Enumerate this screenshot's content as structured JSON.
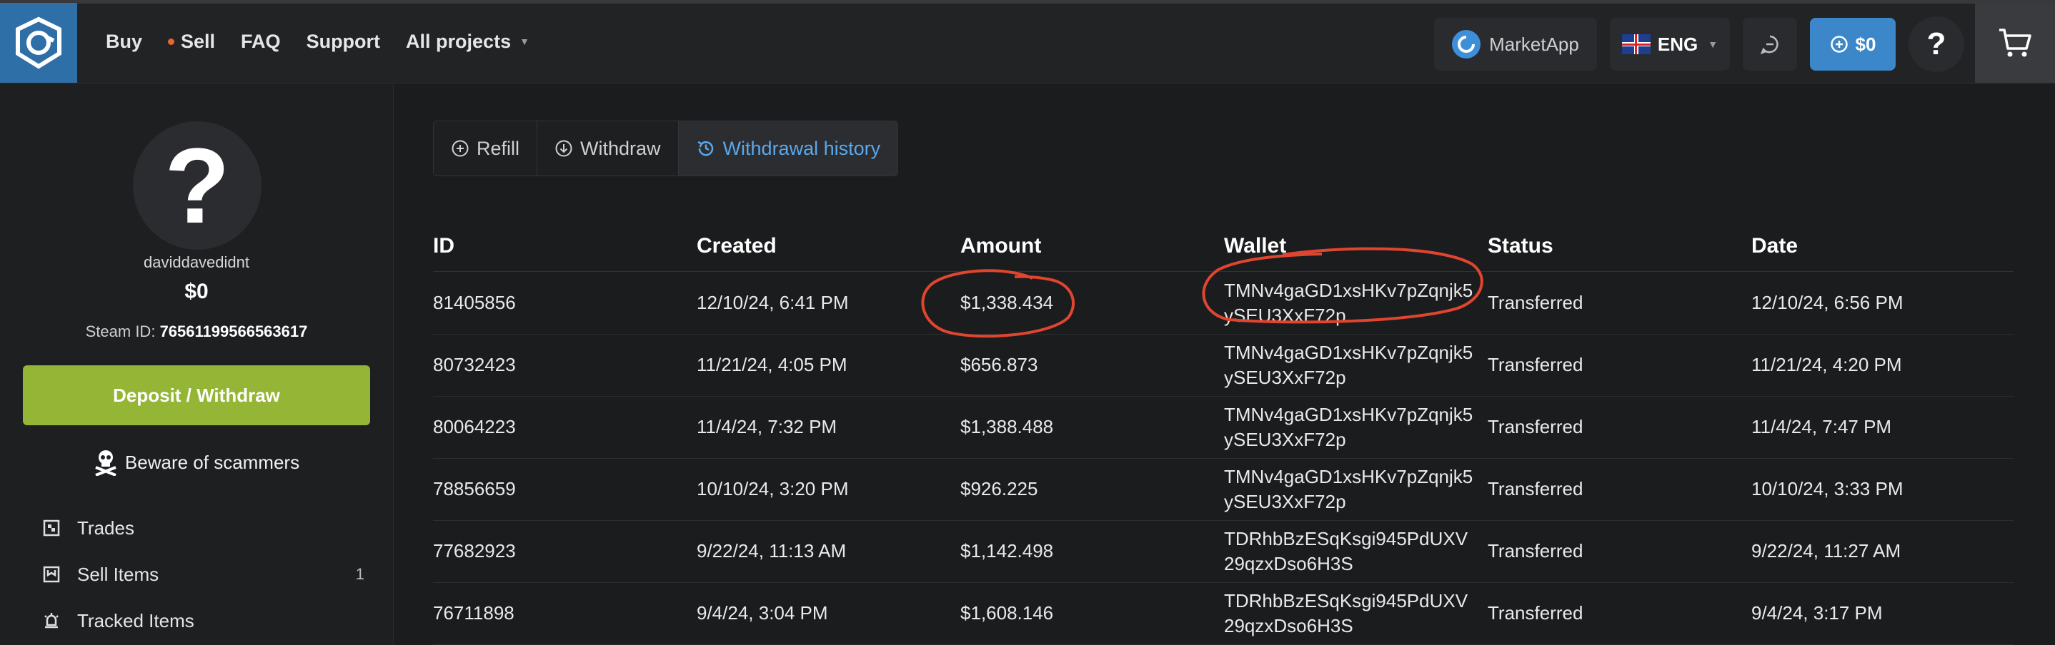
{
  "nav": {
    "items": [
      "Buy",
      "Sell",
      "FAQ",
      "Support",
      "All projects"
    ]
  },
  "topbar": {
    "market_label": "MarketApp",
    "lang_label": "ENG",
    "balance_label": "$0",
    "help_label": "?"
  },
  "profile": {
    "avatar_glyph": "?",
    "username": "daviddavedidnt",
    "balance": "$0",
    "steam_label": "Steam ID:",
    "steam_id": "76561199566563617"
  },
  "sidebar": {
    "deposit_label": "Deposit / Withdraw",
    "scam_label": "Beware of scammers",
    "menu": [
      {
        "label": "Trades",
        "count": "",
        "icon": "trades-icon"
      },
      {
        "label": "Sell Items",
        "count": "1",
        "icon": "sell-items-icon"
      },
      {
        "label": "Tracked Items",
        "count": "",
        "icon": "tracked-items-icon"
      }
    ]
  },
  "tabs": [
    {
      "label": "Refill",
      "icon": "plus-circle-icon"
    },
    {
      "label": "Withdraw",
      "icon": "arrow-down-circle-icon"
    },
    {
      "label": "Withdrawal history",
      "icon": "history-icon"
    }
  ],
  "table": {
    "headers": [
      "ID",
      "Created",
      "Amount",
      "Wallet",
      "Status",
      "Date"
    ],
    "rows": [
      [
        "81405856",
        "12/10/24, 6:41 PM",
        "$1,338.434",
        "TMNv4gaGD1xsHKv7pZqnjk5ySEU3XxF72p",
        "Transferred",
        "12/10/24, 6:56 PM"
      ],
      [
        "80732423",
        "11/21/24, 4:05 PM",
        "$656.873",
        "TMNv4gaGD1xsHKv7pZqnjk5ySEU3XxF72p",
        "Transferred",
        "11/21/24, 4:20 PM"
      ],
      [
        "80064223",
        "11/4/24, 7:32 PM",
        "$1,388.488",
        "TMNv4gaGD1xsHKv7pZqnjk5ySEU3XxF72p",
        "Transferred",
        "11/4/24, 7:47 PM"
      ],
      [
        "78856659",
        "10/10/24, 3:20 PM",
        "$926.225",
        "TMNv4gaGD1xsHKv7pZqnjk5ySEU3XxF72p",
        "Transferred",
        "10/10/24, 3:33 PM"
      ],
      [
        "77682923",
        "9/22/24, 11:13 AM",
        "$1,142.498",
        "TDRhbBzESqKsgi945PdUXV29qzxDso6H3S",
        "Transferred",
        "9/22/24, 11:27 AM"
      ],
      [
        "76711898",
        "9/4/24, 3:04 PM",
        "$1,608.146",
        "TDRhbBzESqKsgi945PdUXV29qzxDso6H3S",
        "Transferred",
        "9/4/24, 3:17 PM"
      ]
    ]
  },
  "colors": {
    "accent_blue": "#3b87c9",
    "deposit_green": "#95b536",
    "sell_dot": "#e8662f",
    "annotation_red": "#e0452f"
  }
}
